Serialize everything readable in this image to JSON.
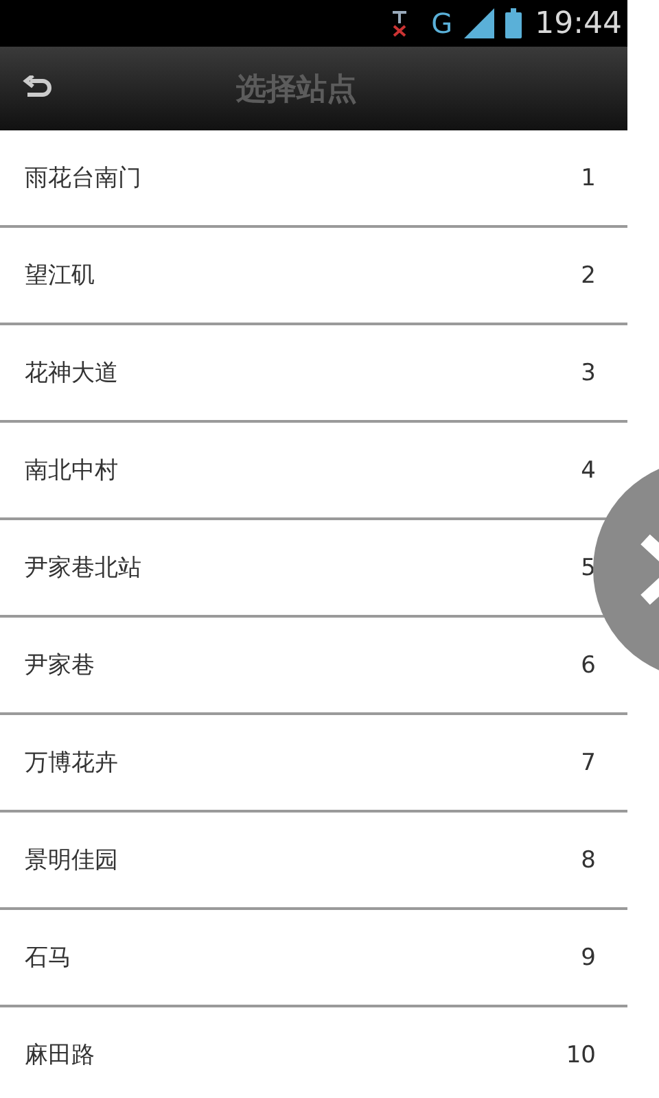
{
  "status_bar": {
    "time": "19:44",
    "network": "G"
  },
  "action_bar": {
    "title": "选择站点"
  },
  "stations": [
    {
      "name": "雨花台南门",
      "number": "1"
    },
    {
      "name": "望江矶",
      "number": "2"
    },
    {
      "name": "花神大道",
      "number": "3"
    },
    {
      "name": "南北中村",
      "number": "4"
    },
    {
      "name": "尹家巷北站",
      "number": "5"
    },
    {
      "name": "尹家巷",
      "number": "6"
    },
    {
      "name": "万博花卉",
      "number": "7"
    },
    {
      "name": "景明佳园",
      "number": "8"
    },
    {
      "name": "石马",
      "number": "9"
    },
    {
      "name": "麻田路",
      "number": "10"
    }
  ]
}
